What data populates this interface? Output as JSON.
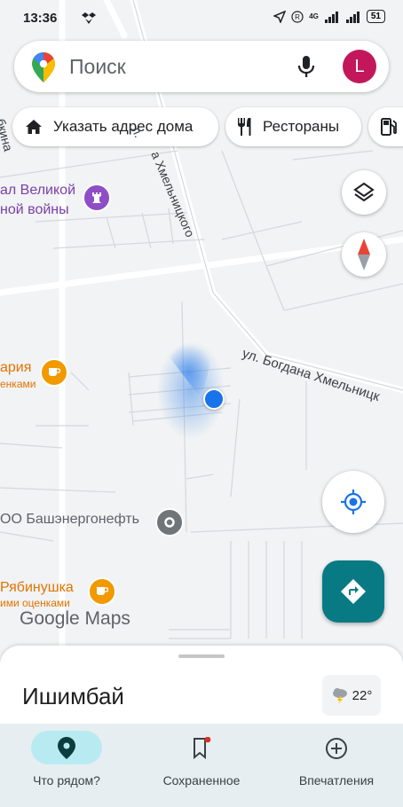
{
  "status_bar": {
    "time": "13:36",
    "network": "4G",
    "battery": "51"
  },
  "search": {
    "placeholder": "Поиск",
    "avatar_letter": "L"
  },
  "chips": [
    {
      "icon": "home-icon",
      "label": "Указать адрес дома"
    },
    {
      "icon": "restaurant-icon",
      "label": "Рестораны"
    },
    {
      "icon": "gas-station-icon",
      "label": ""
    }
  ],
  "map": {
    "street_label_1": "ул. Богдана Хмельницк",
    "street_label_2": "а Хмельницкого",
    "street_label_3": "л.",
    "street_label_4": "бкина",
    "poi_1_line1": "ал Великой",
    "poi_1_line2": "ной войны",
    "poi_2_line1": "ария",
    "poi_2_line2": "енками",
    "poi_3": "ОО Башэнергонефть",
    "poi_4_line1": "Рябинушка",
    "poi_4_line2": "ими оценками",
    "brand": "Google Maps",
    "colors": {
      "poi_purple": "#7b3fa8",
      "poi_orange": "#e37400",
      "poi_gray": "#5f6368",
      "location_blue": "#1a73e8",
      "directions_teal": "#087a84"
    }
  },
  "sheet": {
    "title": "Ишимбай",
    "temperature": "22°",
    "weather_icon": "thunderstorm-icon"
  },
  "bottom_nav": [
    {
      "label": "Что рядом?",
      "icon": "location-pin-icon",
      "active": true
    },
    {
      "label": "Сохраненное",
      "icon": "bookmark-icon",
      "active": false
    },
    {
      "label": "Впечатления",
      "icon": "add-circle-icon",
      "active": false
    }
  ]
}
